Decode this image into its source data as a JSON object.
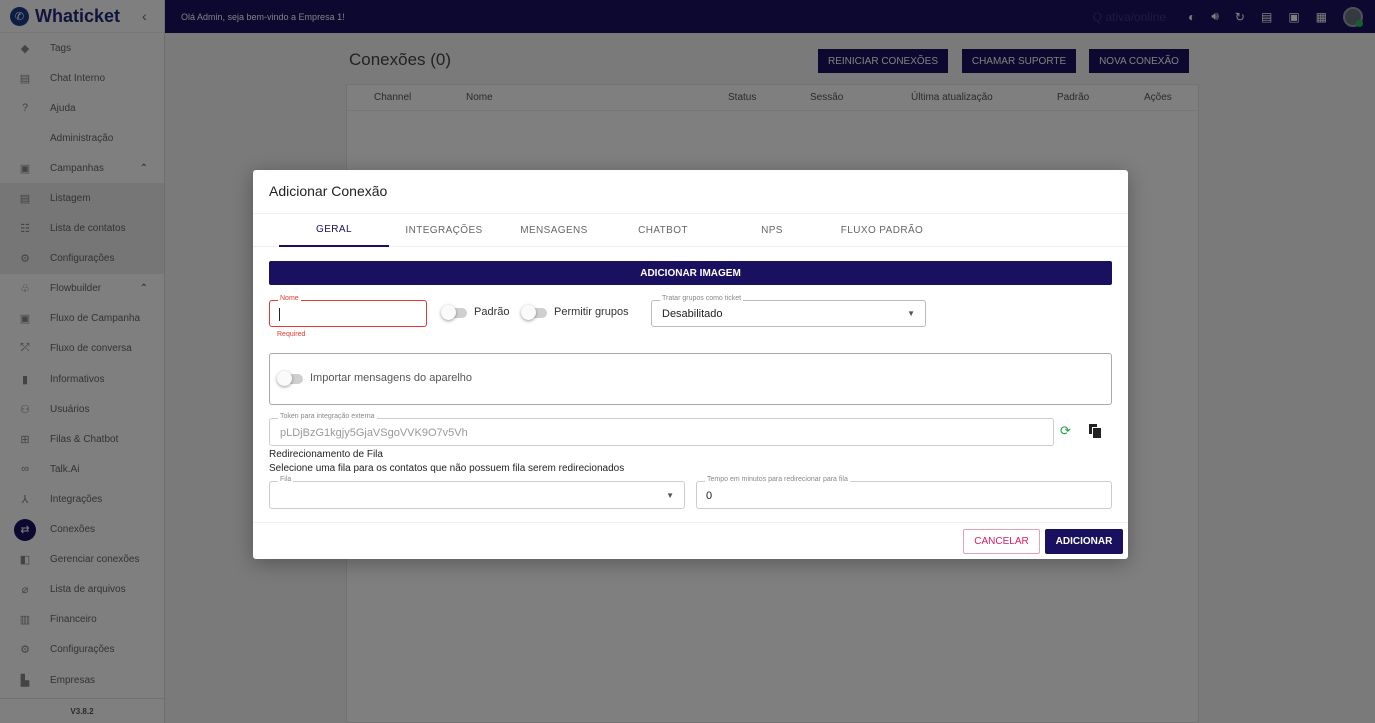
{
  "app": {
    "brand": "Whaticket",
    "version": "V3.8.2"
  },
  "topbar": {
    "welcome": "Olá Admin, seja bem-vindo a Empresa 1!",
    "faint_text": "Q ativa/online"
  },
  "sidebar": {
    "items": [
      {
        "label": "Tags",
        "icon": "tag-icon"
      },
      {
        "label": "Chat Interno",
        "icon": "chat-icon"
      },
      {
        "label": "Ajuda",
        "icon": "help-icon"
      },
      {
        "label": "Administração",
        "section": true
      },
      {
        "label": "Campanhas",
        "icon": "calendar-icon",
        "expandable": true
      },
      {
        "label": "Listagem",
        "icon": "list-icon"
      },
      {
        "label": "Lista de contatos",
        "icon": "contacts-icon"
      },
      {
        "label": "Configurações",
        "icon": "settings-icon"
      },
      {
        "label": "Flowbuilder",
        "icon": "flow-icon",
        "expandable": true
      },
      {
        "label": "Fluxo de Campanha",
        "icon": "campaign-flow-icon"
      },
      {
        "label": "Fluxo de conversa",
        "icon": "conversation-flow-icon"
      },
      {
        "label": "Informativos",
        "icon": "announcement-icon"
      },
      {
        "label": "Usuários",
        "icon": "users-icon"
      },
      {
        "label": "Filas & Chatbot",
        "icon": "queue-icon"
      },
      {
        "label": "Talk.Ai",
        "icon": "infinity-icon"
      },
      {
        "label": "Integrações",
        "icon": "integration-icon"
      },
      {
        "label": "Conexões",
        "icon": "connections-icon",
        "active": true
      },
      {
        "label": "Gerenciar conexões",
        "icon": "manage-icon"
      },
      {
        "label": "Lista de arquivos",
        "icon": "attachment-icon"
      },
      {
        "label": "Financeiro",
        "icon": "finance-icon"
      },
      {
        "label": "Configurações",
        "icon": "settings-icon"
      },
      {
        "label": "Empresas",
        "icon": "business-icon"
      }
    ]
  },
  "main": {
    "title": "Conexões (0)",
    "buttons": {
      "restart": "REINICIAR CONEXÕES",
      "support": "CHAMAR SUPORTE",
      "new": "NOVA CONEXÃO"
    },
    "columns": [
      "Channel",
      "Nome",
      "Status",
      "Sessão",
      "Última atualização",
      "Padrão",
      "Ações"
    ]
  },
  "modal": {
    "title": "Adicionar Conexão",
    "tabs": [
      "GERAL",
      "INTEGRAÇÕES",
      "MENSAGENS",
      "CHATBOT",
      "NPS",
      "FLUXO PADRÃO"
    ],
    "add_image": "ADICIONAR IMAGEM",
    "name_label": "Nome",
    "name_value": "",
    "required": "Required",
    "toggle_padrao": "Padrão",
    "toggle_grupos": "Permitir grupos",
    "tratar_label": "Tratar grupos como ticket",
    "tratar_value": "Desabilitado",
    "importar": "Importar mensagens do aparelho",
    "token_label": "Token para integração externa",
    "token_value": "pLDjBzG1kgjy5GjaVSgoVVK9O7v5Vh",
    "redir_title": "Redirecionamento de Fila",
    "redir_sub": "Selecione uma fila para os contatos que não possuem fila serem redirecionados",
    "fila_label": "Fila",
    "tempo_label": "Tempo em minutos para redirecionar para fila",
    "tempo_value": "0",
    "cancel": "CANCELAR",
    "add": "ADICIONAR"
  }
}
